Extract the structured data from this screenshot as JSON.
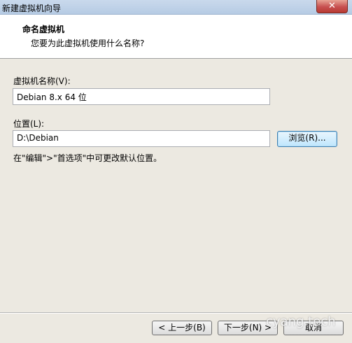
{
  "window": {
    "title": "新建虚拟机向导",
    "close_label": "✕"
  },
  "header": {
    "title": "命名虚拟机",
    "subtitle": "您要为此虚拟机使用什么名称?"
  },
  "name_field": {
    "label": "虚拟机名称(V):",
    "value": "Debian 8.x 64 位"
  },
  "location_field": {
    "label": "位置(L):",
    "value": "D:\\Debian",
    "browse_label": "浏览(R)..."
  },
  "hint": "在\"编辑\">\"首选项\"中可更改默认位置。",
  "footer": {
    "back_label": "< 上一步(B)",
    "next_label": "下一步(N) >",
    "cancel_label": "取消"
  },
  "watermark": "cyang.tech"
}
